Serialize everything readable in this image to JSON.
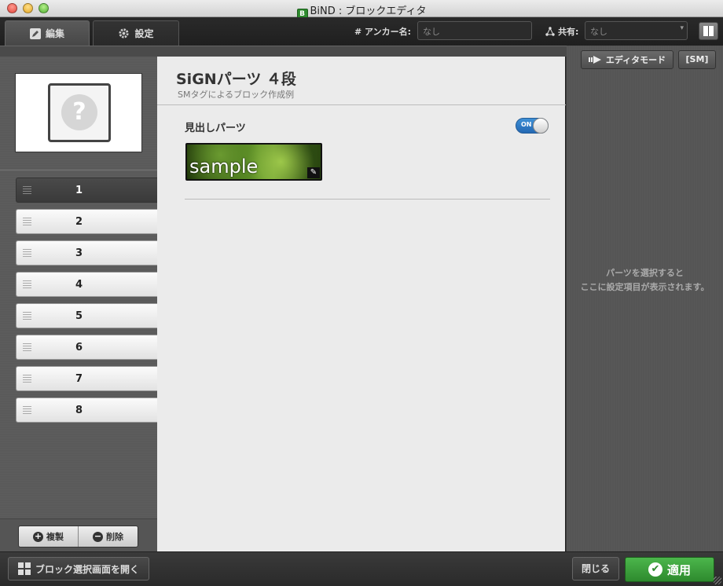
{
  "window": {
    "title": "BiND : ブロックエディタ",
    "app_icon": "B"
  },
  "toolbar": {
    "tab_edit": "編集",
    "tab_settings": "設定",
    "anchor_label": "# アンカー名:",
    "anchor_placeholder": "なし",
    "share_label": "共有:",
    "share_value": "なし"
  },
  "sidebar": {
    "rows": [
      "1",
      "2",
      "3",
      "4",
      "5",
      "6",
      "7",
      "8"
    ],
    "selected": "1",
    "duplicate": "複製",
    "delete": "削除"
  },
  "main": {
    "title": "SiGNパーツ ４段",
    "subtitle": "SMタグによるブロック作成例",
    "part_label": "見出しパーツ",
    "toggle": "ON",
    "sample_text": "sample"
  },
  "right": {
    "editor_mode": "エディタモード",
    "sm": "[SM]",
    "hint_line1": "パーツを選択すると",
    "hint_line2": "ここに設定項目が表示されます。"
  },
  "footer": {
    "open_block": "ブロック選択画面を開く",
    "close": "閉じる",
    "apply": "適用"
  },
  "colors": {
    "apply": "#2e8a2e",
    "toggle": "#2468b3"
  }
}
